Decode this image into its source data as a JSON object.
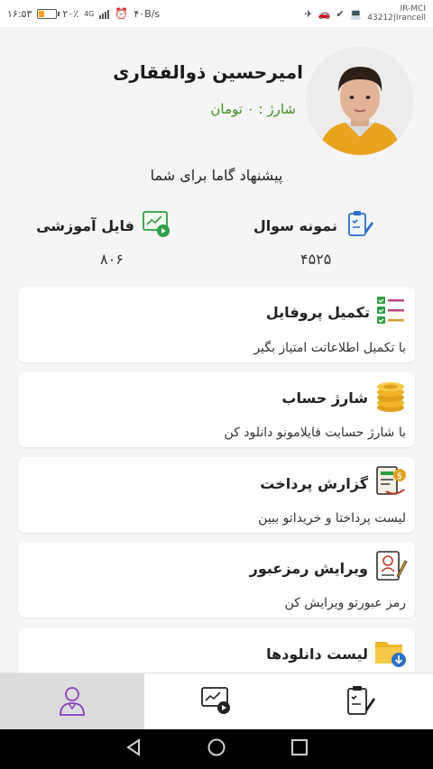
{
  "status_bar": {
    "time": "۱۶:۵۳",
    "battery": "۲۰٪",
    "network": "4G",
    "speed": "۴۰B/s",
    "carrier_line1": "IR-MCI",
    "carrier_line2": "43212|Irancell"
  },
  "profile": {
    "name": "امیرحسین ذوالفقاری",
    "charge": "شارژ : ۰ تومان"
  },
  "suggestion": "پیشنهاد گاما برای شما",
  "stats": [
    {
      "label": "نمونه سوال",
      "value": "۴۵۲۵",
      "icon": "question-sheet-icon"
    },
    {
      "label": "فایل آموزشی",
      "value": "۸۰۶",
      "icon": "video-lesson-icon"
    }
  ],
  "cards": [
    {
      "title": "تکمیل پروفایل",
      "desc": "با تکمیل اطلاعاتت امتیاز بگیر",
      "icon": "checklist-icon"
    },
    {
      "title": "شارژ حساب",
      "desc": "با شارژ حسابت فایلامونو دانلود کن",
      "icon": "coins-icon"
    },
    {
      "title": "گزارش پرداخت",
      "desc": "لیست پرداختا و خریداتو ببین",
      "icon": "payment-report-icon"
    },
    {
      "title": "ویرایش رمزعبور",
      "desc": "رمز عبورتو ویرایش کن",
      "icon": "password-edit-icon"
    },
    {
      "title": "لیست دانلودها",
      "desc": "",
      "icon": "download-folder-icon"
    }
  ],
  "tabs": [
    {
      "name": "profile-tab",
      "icon": "user-icon",
      "active": true
    },
    {
      "name": "lessons-tab",
      "icon": "video-lesson-icon",
      "active": false
    },
    {
      "name": "questions-tab",
      "icon": "exam-edit-icon",
      "active": false
    }
  ],
  "colors": {
    "charge_text": "#3f8f1f",
    "active_tab": "#dcdcdc",
    "accent_purple": "#8a3fc1",
    "accent_blue": "#2a6fc7"
  }
}
